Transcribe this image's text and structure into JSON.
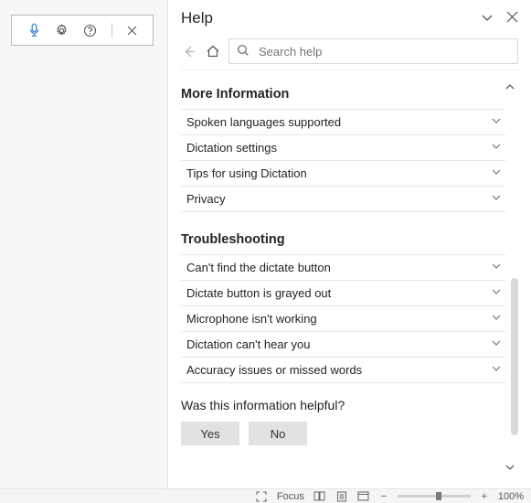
{
  "help": {
    "title": "Help",
    "search_placeholder": "Search help",
    "sections": {
      "more_info": {
        "title": "More Information",
        "items": [
          "Spoken languages supported",
          "Dictation settings",
          "Tips for using Dictation",
          "Privacy"
        ]
      },
      "troubleshooting": {
        "title": "Troubleshooting",
        "items": [
          "Can't find the dictate button",
          "Dictate button is grayed out",
          "Microphone isn't working",
          "Dictation can't hear you",
          "Accuracy issues or missed words"
        ]
      }
    },
    "feedback": {
      "question": "Was this information helpful?",
      "yes": "Yes",
      "no": "No"
    }
  },
  "statusbar": {
    "focus": "Focus",
    "zoom": "100%"
  }
}
